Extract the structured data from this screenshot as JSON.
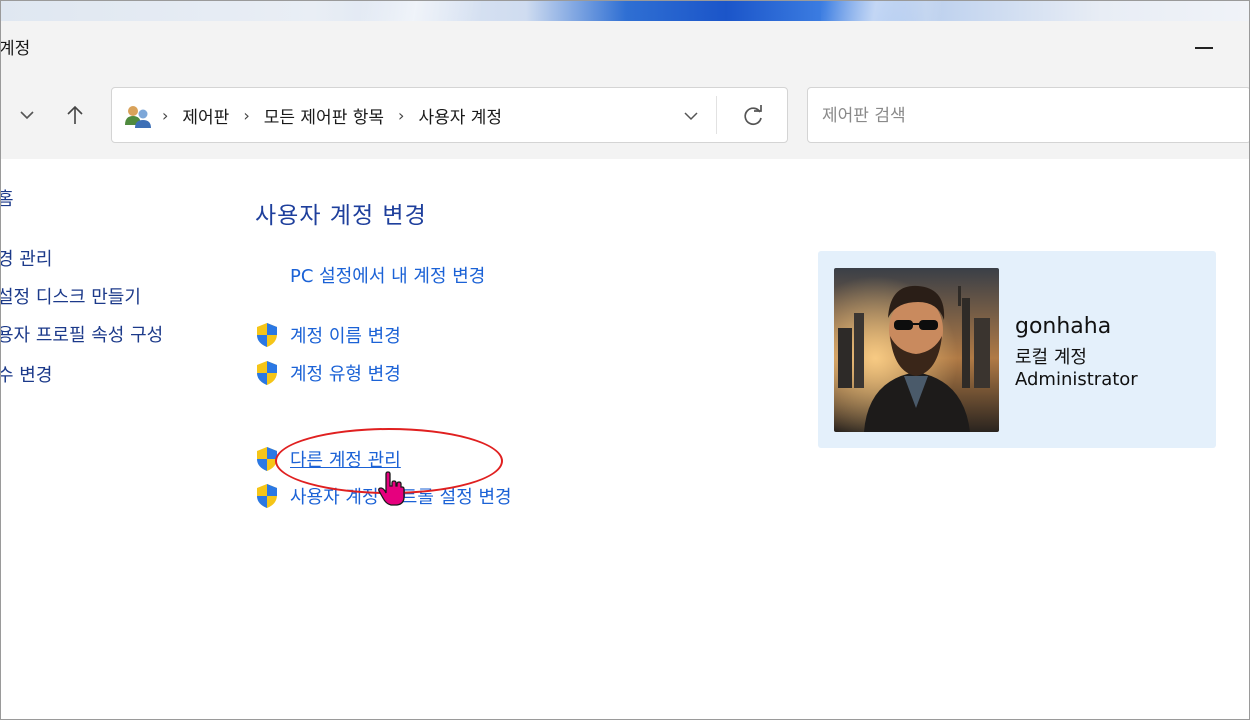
{
  "window": {
    "title": "계정",
    "minimize_icon": "minimize-icon"
  },
  "navigation": {
    "buttons": [
      "chevron-down-icon",
      "up-arrow-icon"
    ],
    "address_icon": "user-accounts-icon",
    "breadcrumbs": [
      "제어판",
      "모든 제어판 항목",
      "사용자 계정"
    ],
    "dropdown_icon": "chevron-down-icon",
    "refresh_icon": "refresh-icon"
  },
  "search": {
    "placeholder": "제어판 검색",
    "value": ""
  },
  "left_pane": {
    "items": [
      "홈",
      "경 관리",
      "설정 디스크 만들기",
      "용자 프로필 속성 구성",
      "수 변경"
    ]
  },
  "main": {
    "heading": "사용자 계정 변경",
    "tasks": [
      {
        "label": "PC 설정에서 내 계정 변경",
        "shield": false
      },
      {
        "label": "계정 이름 변경",
        "shield": true
      },
      {
        "label": "계정 유형 변경",
        "shield": true
      },
      {
        "label": "다른 계정 관리",
        "shield": true
      },
      {
        "label": "사용자 계정 컨트롤 설정 변경",
        "shield": true
      }
    ]
  },
  "user": {
    "name": "gonhaha",
    "account_type": "로컬 계정",
    "role": "Administrator"
  },
  "colors": {
    "link": "#1b62d6",
    "heading": "#1e3f9c",
    "card_bg": "#e4f0fb",
    "highlight_ellipse": "#e02020",
    "cursor": "#e6007e"
  }
}
